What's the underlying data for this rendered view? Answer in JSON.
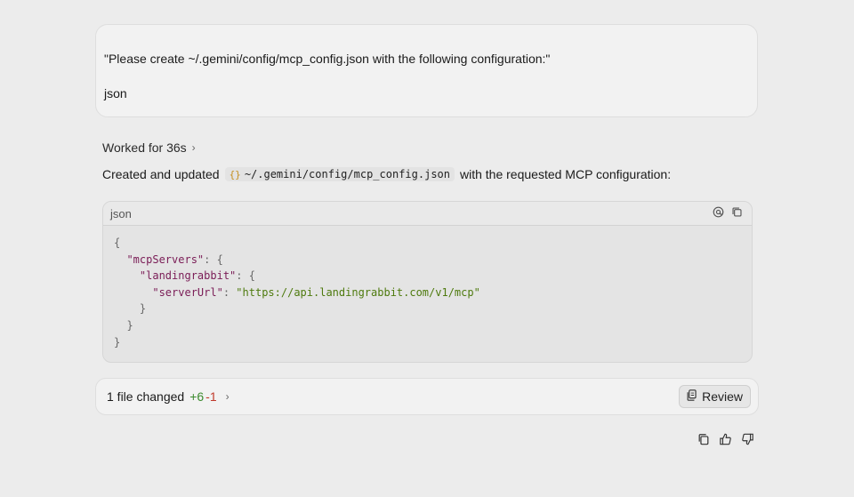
{
  "user_message": {
    "line1": "\"Please create ~/.gemini/config/mcp_config.json with the following configuration:\"",
    "line2": "json"
  },
  "worked": {
    "label": "Worked for 36s",
    "chevron": "›"
  },
  "response": {
    "prefix": "Created and updated",
    "file_icon": "{}",
    "file_path": "~/.gemini/config/mcp_config.json",
    "suffix": "with the requested MCP configuration:"
  },
  "code": {
    "language": "json",
    "lines": {
      "l1": "{",
      "l2_key": "\"mcpServers\"",
      "l2_rest": ": {",
      "l3_key": "\"landingrabbit\"",
      "l3_rest": ": {",
      "l4_key": "\"serverUrl\"",
      "l4_colon": ": ",
      "l4_val": "\"https://api.landingrabbit.com/v1/mcp\"",
      "l5": "}",
      "l6": "}",
      "l7": "}"
    }
  },
  "changes": {
    "label": "1 file changed",
    "additions": "+6",
    "deletions": "-1",
    "review_label": "Review"
  },
  "icons": {
    "at": "at-icon",
    "copy": "copy-icon",
    "review": "review-icon",
    "thumbs_up": "thumbs-up-icon",
    "thumbs_down": "thumbs-down-icon"
  }
}
